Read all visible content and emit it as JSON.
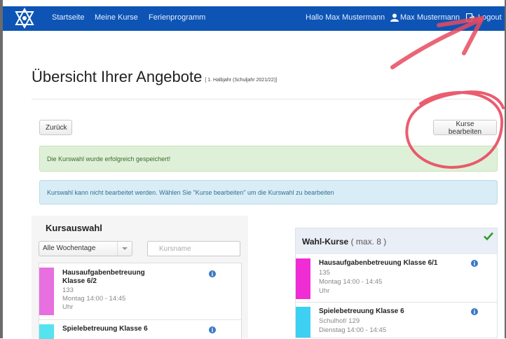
{
  "nav": {
    "links": [
      "Startseite",
      "Meine Kurse",
      "Ferienprogramm"
    ],
    "greeting": "Hallo Max Mustermann",
    "user_name": "Max Mustermann",
    "logout_label": "Logout",
    "background": "#0d54b5"
  },
  "page": {
    "title": "Übersicht Ihrer Angebote",
    "subtitle": "[ 1. Halbjahr (Schuljahr 2021/22)]"
  },
  "toolbar": {
    "back_label": "Zurück",
    "edit_label": "Kurse bearbeiten"
  },
  "alerts": {
    "success": "Die Kurswahl wurde erfolgreich gespeichert!",
    "info": "Kurswahl kann nicht bearbeitet werden. Wählen Sie \"Kurse bearbeiten\" um die Kurswahl zu bearbeiten"
  },
  "course_selection": {
    "title": "Kursauswahl",
    "weekday_filter": "Alle Wochentage",
    "search_placeholder": "Kursname",
    "items": [
      {
        "name_line1": "Hausaufgabenbetreuung",
        "name_line2": "Klasse 6/2",
        "room": "133",
        "time_line1": "Montag 14:00 - 14:45",
        "time_line2": "Uhr",
        "color": "#e86fe0",
        "icon": "info-icon"
      },
      {
        "name_line1": "Spielebetreuung Klasse 6",
        "color": "#55e3ef",
        "icon": "info-icon"
      }
    ]
  },
  "elective": {
    "title": "Wahl-Kurse",
    "max_label": "( max. 8 )",
    "status_icon": "checkmark-icon",
    "status_color": "#2e9e2e",
    "items": [
      {
        "name": "Hausaufgabenbetreuung Klasse 6/1",
        "room": "135",
        "time_line1": "Montag 14:00 - 14:45",
        "time_line2": "Uhr",
        "color": "#f02cd4",
        "icon": "info-icon"
      },
      {
        "name": "Spielebetreuung Klasse 6",
        "room": "Schulhof/ 129",
        "time_line1": "Dienstag 14:00 - 14:45",
        "color": "#3dd0f2",
        "icon": "info-icon"
      }
    ]
  },
  "annotation_color": "#e84a5f"
}
